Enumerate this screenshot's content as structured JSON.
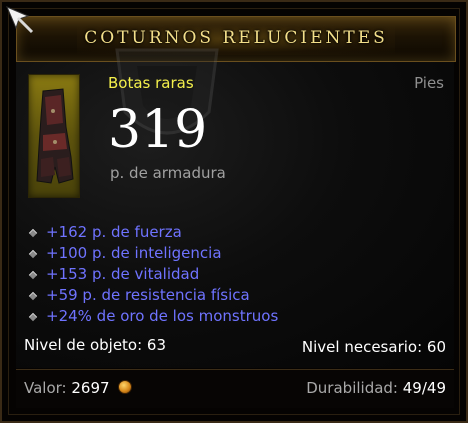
{
  "item": {
    "name": "COTURNOS RELUCIENTES",
    "quality": "Botas raras",
    "slot": "Pies",
    "armor_value": "319",
    "armor_label": "p. de armadura"
  },
  "stats": [
    "+162 p. de fuerza",
    "+100 p. de inteligencia",
    "+153 p. de vitalidad",
    "+59 p. de resistencia física",
    "+24% de oro de los monstruos"
  ],
  "levels": {
    "item_level": "Nivel de objeto: 63",
    "required_level": "Nivel necesario: 60"
  },
  "footer": {
    "value_label": "Valor:",
    "value_amount": "2697",
    "durability_label": "Durabilidad:",
    "durability_value": "49/49"
  },
  "colors": {
    "title": "#f3df8a",
    "rare_yellow": "#f4f04c",
    "magic_blue": "#6f73ff",
    "gray_text": "#a9a9a9"
  }
}
